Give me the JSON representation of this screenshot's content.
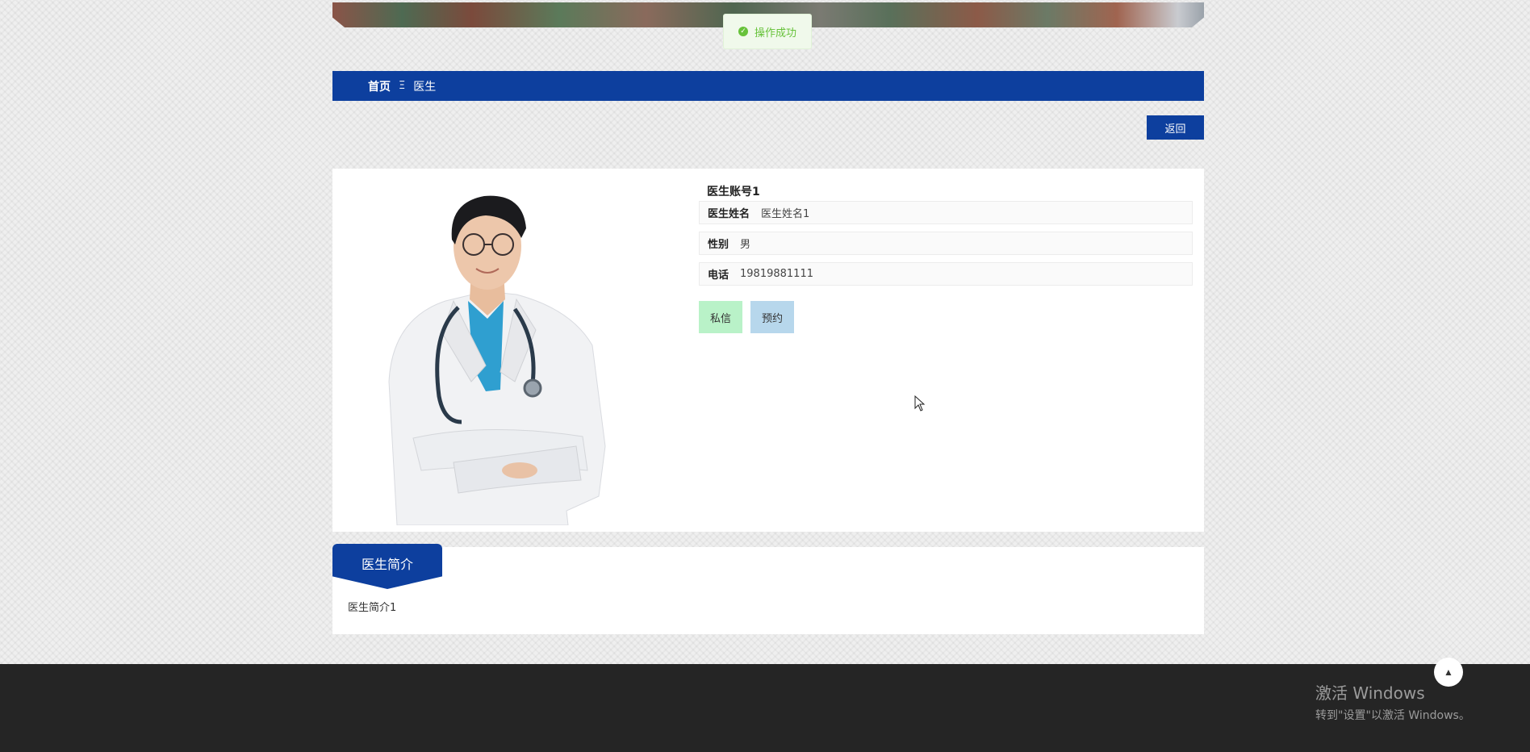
{
  "toast": {
    "text": "操作成功"
  },
  "breadcrumb": {
    "home": "首页",
    "separator": "Ξ",
    "current": "医生"
  },
  "actions": {
    "back_label": "返回"
  },
  "doctor": {
    "account": "医生账号1",
    "fields": [
      {
        "label": "医生姓名",
        "value": "医生姓名1"
      },
      {
        "label": "性别",
        "value": "男"
      },
      {
        "label": "电话",
        "value": "19819881111"
      }
    ],
    "message_label": "私信",
    "booking_label": "预约"
  },
  "intro": {
    "title": "医生简介",
    "text": "医生简介1"
  },
  "windows": {
    "line1": "激活 Windows",
    "line2": "转到\"设置\"以激活 Windows。"
  },
  "colors": {
    "brand": "#0d3f9e",
    "success": "#67c23a",
    "message_btn": "#b9f2c8",
    "booking_btn": "#b7d7ec",
    "footer": "#252525"
  },
  "icons": {
    "toast": "check-circle-icon",
    "back_to_top": "caret-up-icon",
    "cursor": "mouse-pointer-icon"
  }
}
